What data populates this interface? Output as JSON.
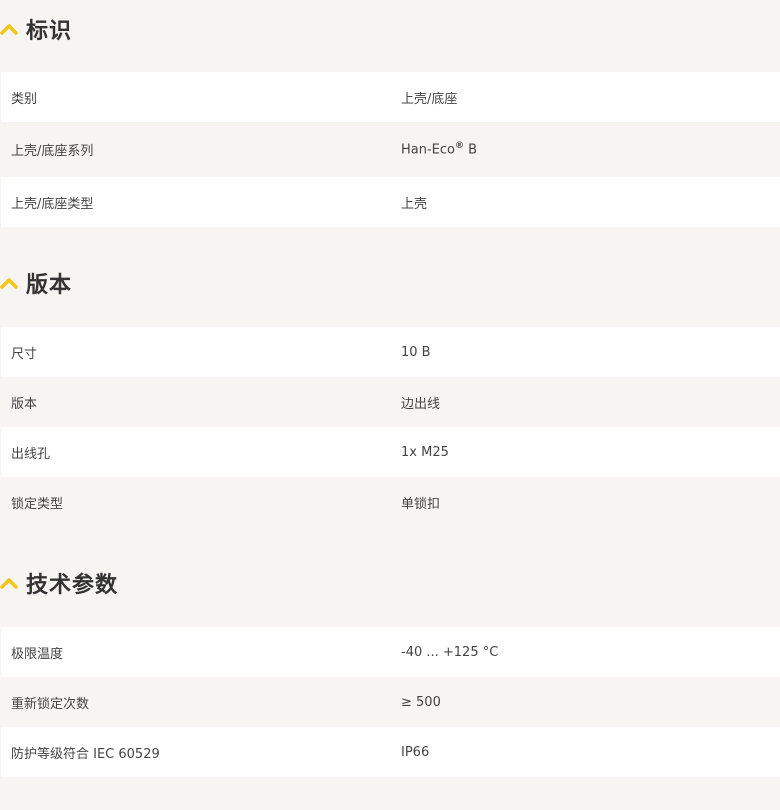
{
  "accent_color": "#f5c518",
  "sections": [
    {
      "title": "标识",
      "icon": "chevron-up-icon",
      "rows": [
        {
          "label": "类别",
          "value": "上壳/底座"
        },
        {
          "label": "上壳/底座系列",
          "value": "Han-Eco",
          "value_sup": "®",
          "value_suffix": " B"
        },
        {
          "label": "上壳/底座类型",
          "value": "上壳"
        }
      ]
    },
    {
      "title": "版本",
      "icon": "chevron-up-icon",
      "rows": [
        {
          "label": "尺寸",
          "value": "10 B"
        },
        {
          "label": "版本",
          "value": "边出线"
        },
        {
          "label": "出线孔",
          "value": "1x M25"
        },
        {
          "label": "锁定类型",
          "value": "单锁扣"
        }
      ]
    },
    {
      "title": "技术参数",
      "icon": "chevron-up-icon",
      "rows": [
        {
          "label": "极限温度",
          "value": "-40 ... +125 °C"
        },
        {
          "label": "重新锁定次数",
          "value": "≥ 500"
        },
        {
          "label": "防护等级符合 IEC 60529",
          "value": "IP66"
        }
      ]
    }
  ]
}
